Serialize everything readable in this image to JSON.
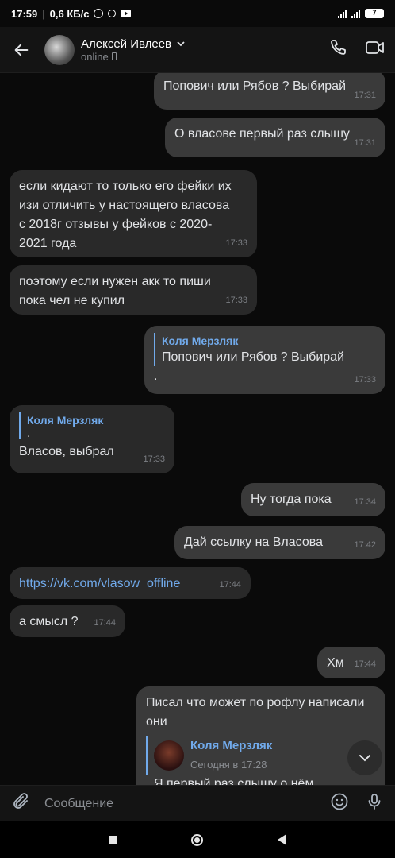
{
  "status_bar": {
    "time": "17:59",
    "speed": "0,6 КБ/с",
    "battery": "7"
  },
  "header": {
    "contact_name": "Алексей Ивлеев",
    "contact_status": "online"
  },
  "messages": [
    {
      "dir": "out",
      "text": "Попович или Рябов  ? Выбирай",
      "time": "17:31"
    },
    {
      "dir": "out",
      "text": "О власове первый раз слышу",
      "time": "17:31"
    },
    {
      "dir": "in",
      "text": "если кидают то только его фейки их изи отличить у настоящего власова с 2018г отзывы у фейков с 2020-2021 года",
      "time": "17:33"
    },
    {
      "dir": "in",
      "text": "поэтому если нужен акк то пиши пока чел не купил",
      "time": "17:33"
    },
    {
      "dir": "out",
      "reply_name": "Коля Мерзляк",
      "reply_text": "Попович или Рябов  ? Выбирай",
      "text": ".",
      "time": "17:33"
    },
    {
      "dir": "in",
      "reply_name": "Коля Мерзляк",
      "reply_text": ".",
      "text": "Власов, выбрал",
      "time": "17:33"
    },
    {
      "dir": "out",
      "text": "Ну тогда пока",
      "time": "17:34"
    },
    {
      "dir": "out",
      "text": "Дай ссылку на Власова",
      "time": "17:42"
    },
    {
      "dir": "in",
      "text": "https://vk.com/vlasow_offline",
      "time": "17:44"
    },
    {
      "dir": "in",
      "text": "а смысл ?",
      "time": "17:44"
    },
    {
      "dir": "out",
      "text": "Хм",
      "time": "17:44"
    },
    {
      "dir": "out",
      "text": "Писал что может по рофлу написали они",
      "fwd_name": "Коля Мерзляк",
      "fwd_date": "Сегодня в 17:28",
      "fwd_text": "Я первый раз слышу о нём"
    }
  ],
  "composer": {
    "placeholder": "Сообщение"
  },
  "icons": {
    "back": "arrow-left-icon",
    "call": "phone-icon",
    "video": "video-camera-icon",
    "attach": "paperclip-icon",
    "emoji": "smile-icon",
    "mic": "microphone-icon",
    "scroll": "chevron-down-icon"
  }
}
